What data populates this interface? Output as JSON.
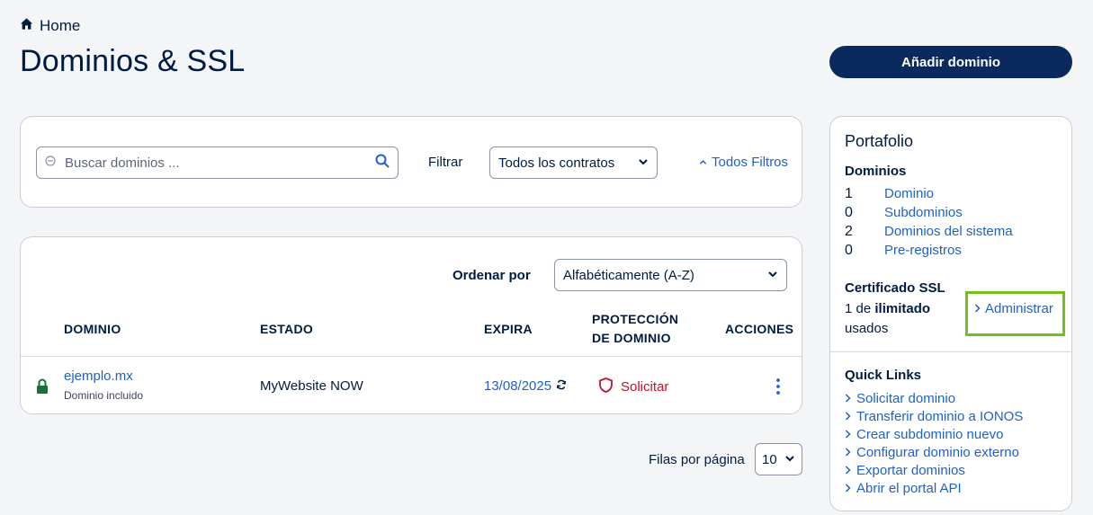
{
  "breadcrumb": {
    "home_label": "Home"
  },
  "page": {
    "title": "Dominios & SSL",
    "add_button": "Añadir dominio"
  },
  "filter": {
    "search_placeholder": "Buscar dominios ...",
    "filter_label": "Filtrar",
    "contract_select": "Todos los contratos",
    "all_filters": "Todos Filtros"
  },
  "domains": {
    "sort_label": "Ordenar por",
    "sort_select": "Alfabéticamente (A-Z)",
    "columns": {
      "domain": "DOMINIO",
      "status": "ESTADO",
      "expires": "EXPIRA",
      "protection_line1": "PROTECCIÓN",
      "protection_line2": "DE DOMINIO",
      "actions": "ACCIONES"
    },
    "rows": [
      {
        "name": "ejemplo.mx",
        "sub": "Dominio incluido",
        "status": "MyWebsite NOW",
        "expires": "13/08/2025",
        "protection": "Solicitar"
      }
    ],
    "rows_per_page_label": "Filas por página",
    "rows_per_page": "10"
  },
  "portfolio": {
    "title": "Portafolio",
    "domains_heading": "Dominios",
    "stats": [
      {
        "count": "1",
        "label": "Dominio"
      },
      {
        "count": "0",
        "label": "Subdominios"
      },
      {
        "count": "2",
        "label": "Dominios del sistema"
      },
      {
        "count": "0",
        "label": "Pre-registros"
      }
    ],
    "ssl_heading": "Certificado SSL",
    "ssl_prefix": "1 de ",
    "ssl_bold": "ilimitado",
    "ssl_suffix": "usados",
    "manage_link": "Administrar",
    "quick_links_heading": "Quick Links",
    "quick_links": [
      "Solicitar dominio",
      "Transferir dominio a IONOS",
      "Crear subdominio nuevo",
      "Configurar dominio externo",
      "Exportar dominios",
      "Abrir el portal API"
    ]
  },
  "colors": {
    "primary_navy": "#0a2a5e",
    "link_blue": "#1f61c4",
    "danger_red": "#c8102e",
    "lock_green": "#13723a",
    "highlight_green": "#71c118"
  }
}
